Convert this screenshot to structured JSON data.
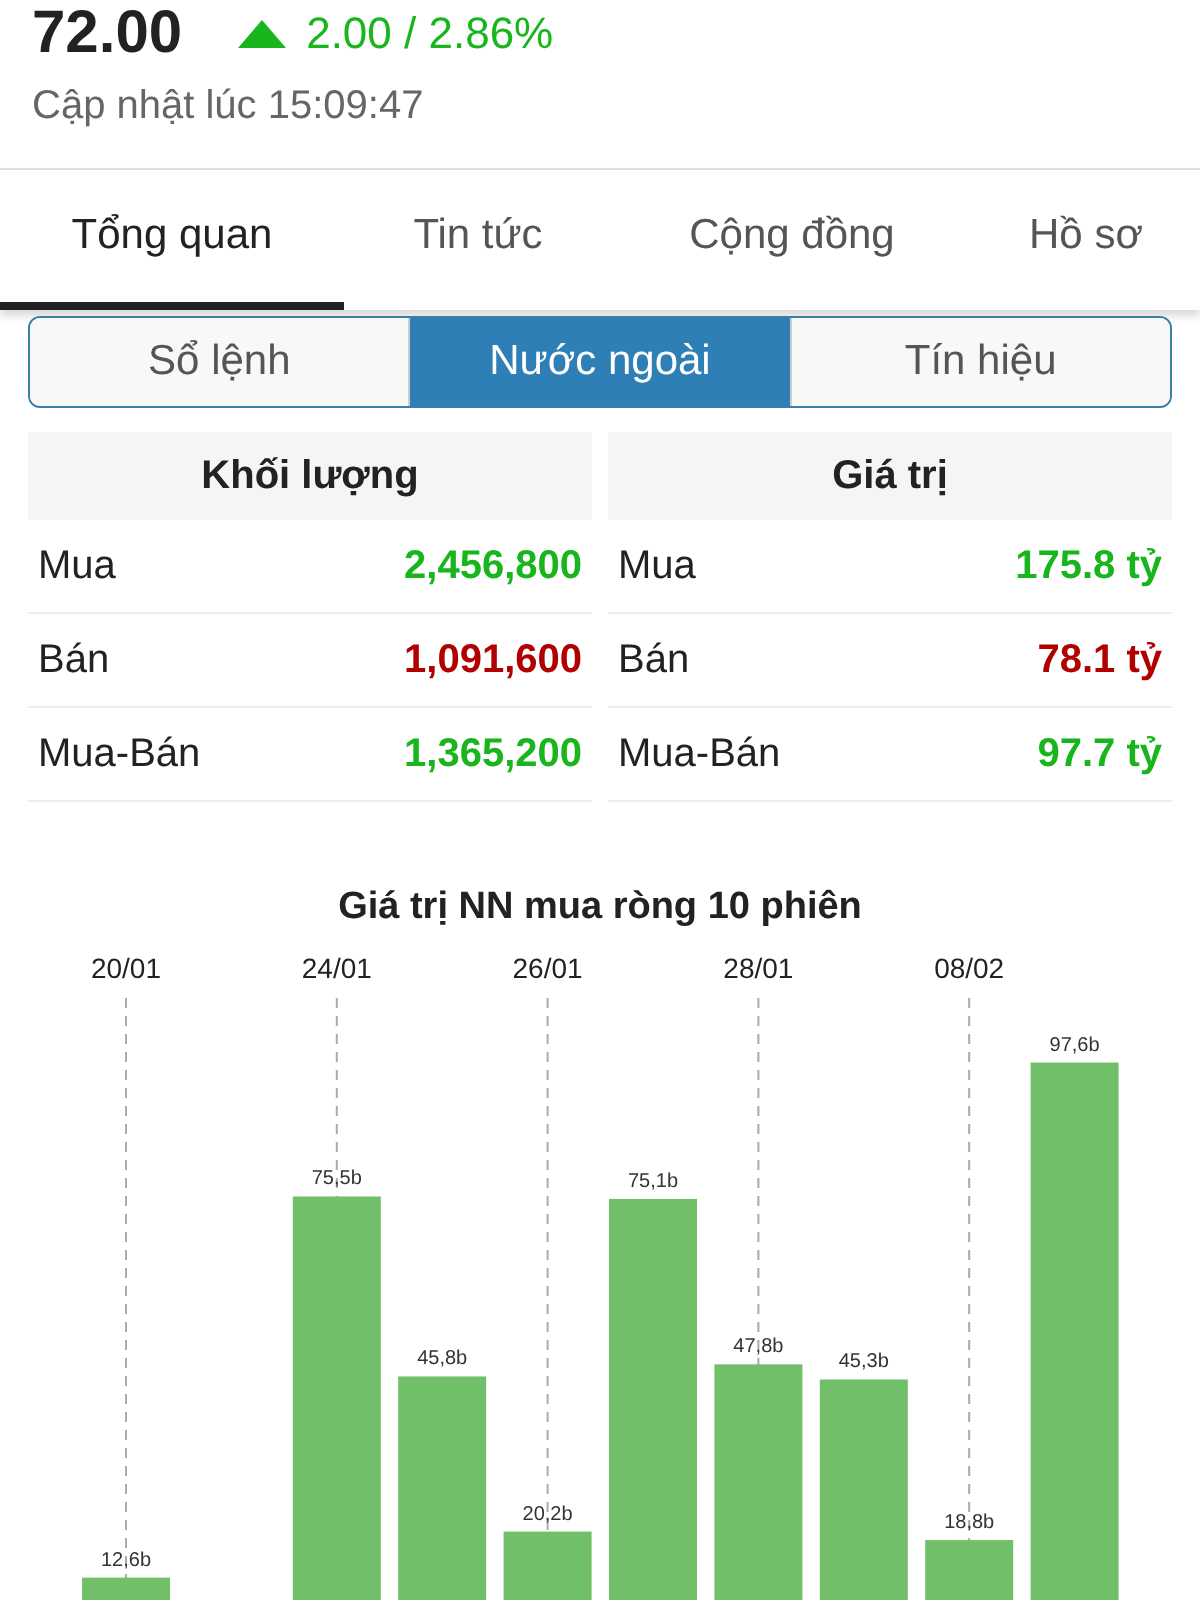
{
  "quote": {
    "price": "72.00",
    "rising": true,
    "change": "2.00 / 2.86%",
    "updated": "Cập nhật lúc 15:09:47"
  },
  "tabs": [
    {
      "label": "Tổng quan",
      "selected": true
    },
    {
      "label": "Tin tức",
      "selected": false
    },
    {
      "label": "Cộng đồng",
      "selected": false
    },
    {
      "label": "Hồ sơ",
      "selected": false
    }
  ],
  "segments": [
    {
      "label": "Sổ lệnh",
      "selected": false
    },
    {
      "label": "Nước ngoài",
      "selected": true
    },
    {
      "label": "Tín hiệu",
      "selected": false
    }
  ],
  "tables": [
    {
      "title": "Khối lượng",
      "rows": [
        {
          "label": "Mua",
          "value": "2,456,800",
          "color": "#19b51c"
        },
        {
          "label": "Bán",
          "value": "1,091,600",
          "color": "#b00000"
        },
        {
          "label": "Mua-Bán",
          "value": "1,365,200",
          "color": "#19b51c"
        }
      ]
    },
    {
      "title": "Giá trị",
      "rows": [
        {
          "label": "Mua",
          "value": "175.8 tỷ",
          "color": "#19b51c"
        },
        {
          "label": "Bán",
          "value": "78.1 tỷ",
          "color": "#b00000"
        },
        {
          "label": "Mua-Bán",
          "value": "97.7 tỷ",
          "color": "#19b51c"
        }
      ]
    }
  ],
  "chart": {
    "chart_data": {
      "type": "bar",
      "title": "Giá trị NN mua ròng 10 phiên",
      "grid": true,
      "categories": [
        "20/01",
        null,
        "24/01",
        null,
        "26/01",
        null,
        "28/01",
        null,
        "08/02",
        null
      ],
      "values": [
        12.6,
        null,
        75.5,
        45.8,
        20.2,
        75.1,
        47.8,
        45.3,
        18.8,
        97.6
      ],
      "value_labels": [
        "12,6b",
        null,
        "75,5b",
        "45,8b",
        "20,2b",
        "75,1b",
        "47,8b",
        "45,3b",
        "18,8b",
        "97,6b"
      ]
    }
  }
}
